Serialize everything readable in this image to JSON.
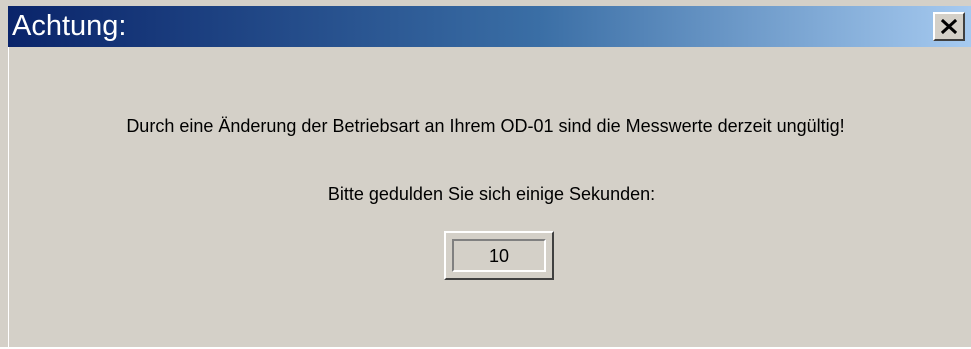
{
  "window": {
    "title": "Achtung:",
    "close_icon": "close-icon",
    "colors": {
      "titlebar_start": "#0a246a",
      "titlebar_end": "#a6caf0",
      "background": "#d4d0c8"
    }
  },
  "content": {
    "message": "Durch eine Änderung der Betriebsart an Ihrem OD-01 sind die Messwerte derzeit ungültig!",
    "prompt": "Bitte gedulden Sie sich einige Sekunden:",
    "countdown": "10"
  }
}
